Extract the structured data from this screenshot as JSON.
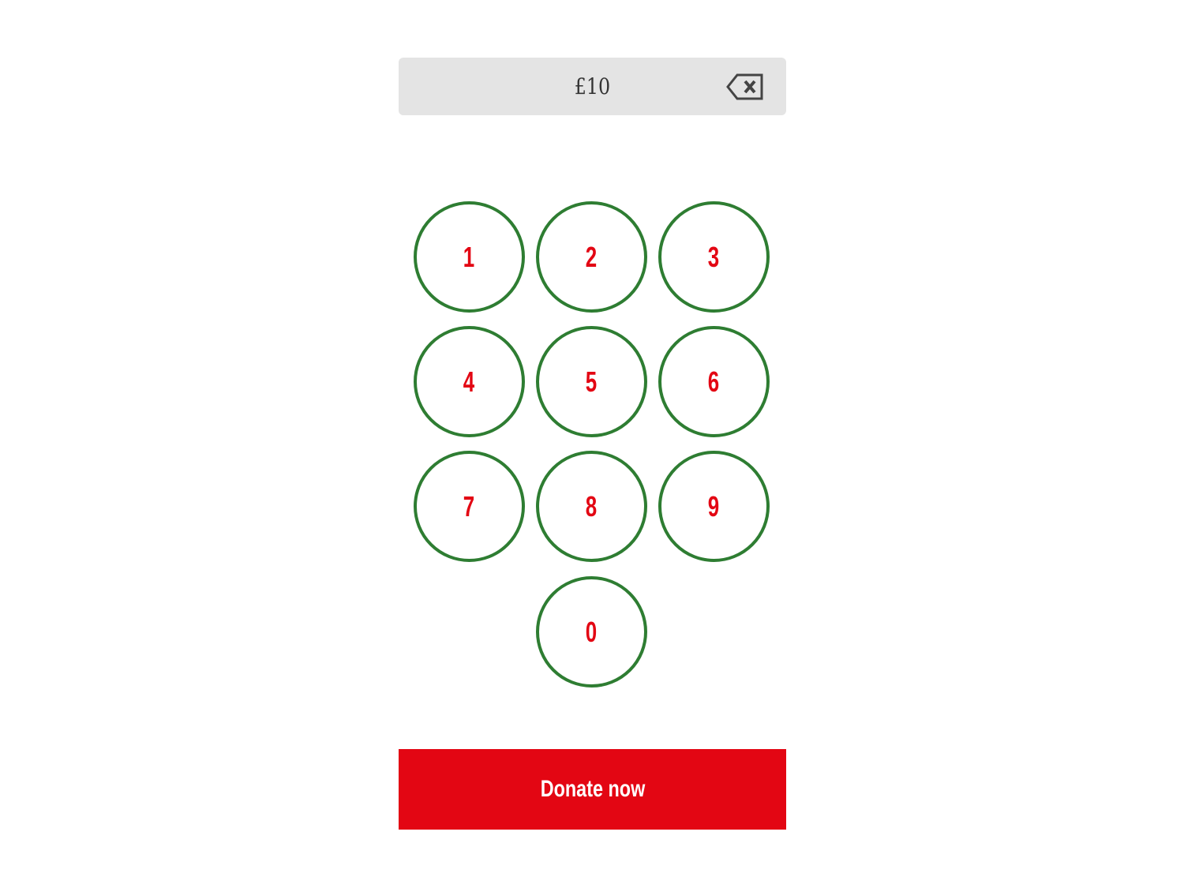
{
  "amount": {
    "display": "£10",
    "backspace_icon": "backspace-icon"
  },
  "keypad": {
    "keys": [
      "1",
      "2",
      "3",
      "4",
      "5",
      "6",
      "7",
      "8",
      "9",
      "0"
    ]
  },
  "donate": {
    "label": "Donate now"
  },
  "colors": {
    "accent_red": "#e30613",
    "key_border_green": "#2e7d32",
    "amount_bg": "#e4e4e4"
  }
}
